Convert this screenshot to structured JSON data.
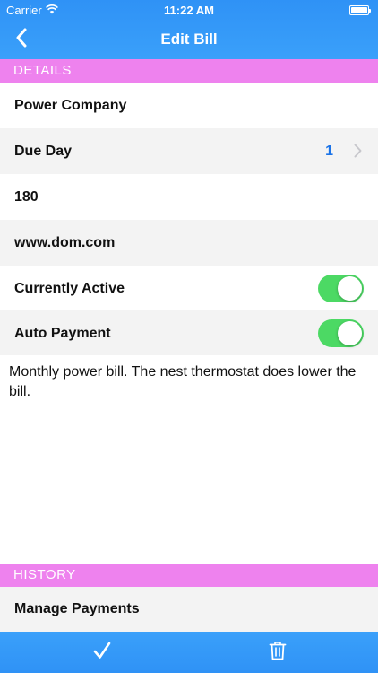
{
  "status_bar": {
    "carrier": "Carrier",
    "time": "11:22 AM"
  },
  "nav": {
    "title": "Edit Bill",
    "back_icon": "chevron-left-icon"
  },
  "sections": {
    "details": "DETAILS",
    "history": "HISTORY"
  },
  "fields": {
    "name": "Power Company",
    "due_day_label": "Due Day",
    "due_day_value": "1",
    "amount": "180",
    "website": "www.dom.com",
    "currently_active_label": "Currently Active",
    "currently_active": true,
    "auto_payment_label": "Auto Payment",
    "auto_payment": true
  },
  "notes": "Monthly power bill. The nest thermostat does lower the bill.",
  "history": {
    "manage_payments": "Manage Payments"
  },
  "toolbar": {
    "save_icon": "checkmark-icon",
    "delete_icon": "trash-icon"
  },
  "colors": {
    "bar_blue": "#3aa0fa",
    "section_pink": "#ee82ee",
    "toggle_green": "#4cd964",
    "value_blue": "#1a73e8"
  }
}
